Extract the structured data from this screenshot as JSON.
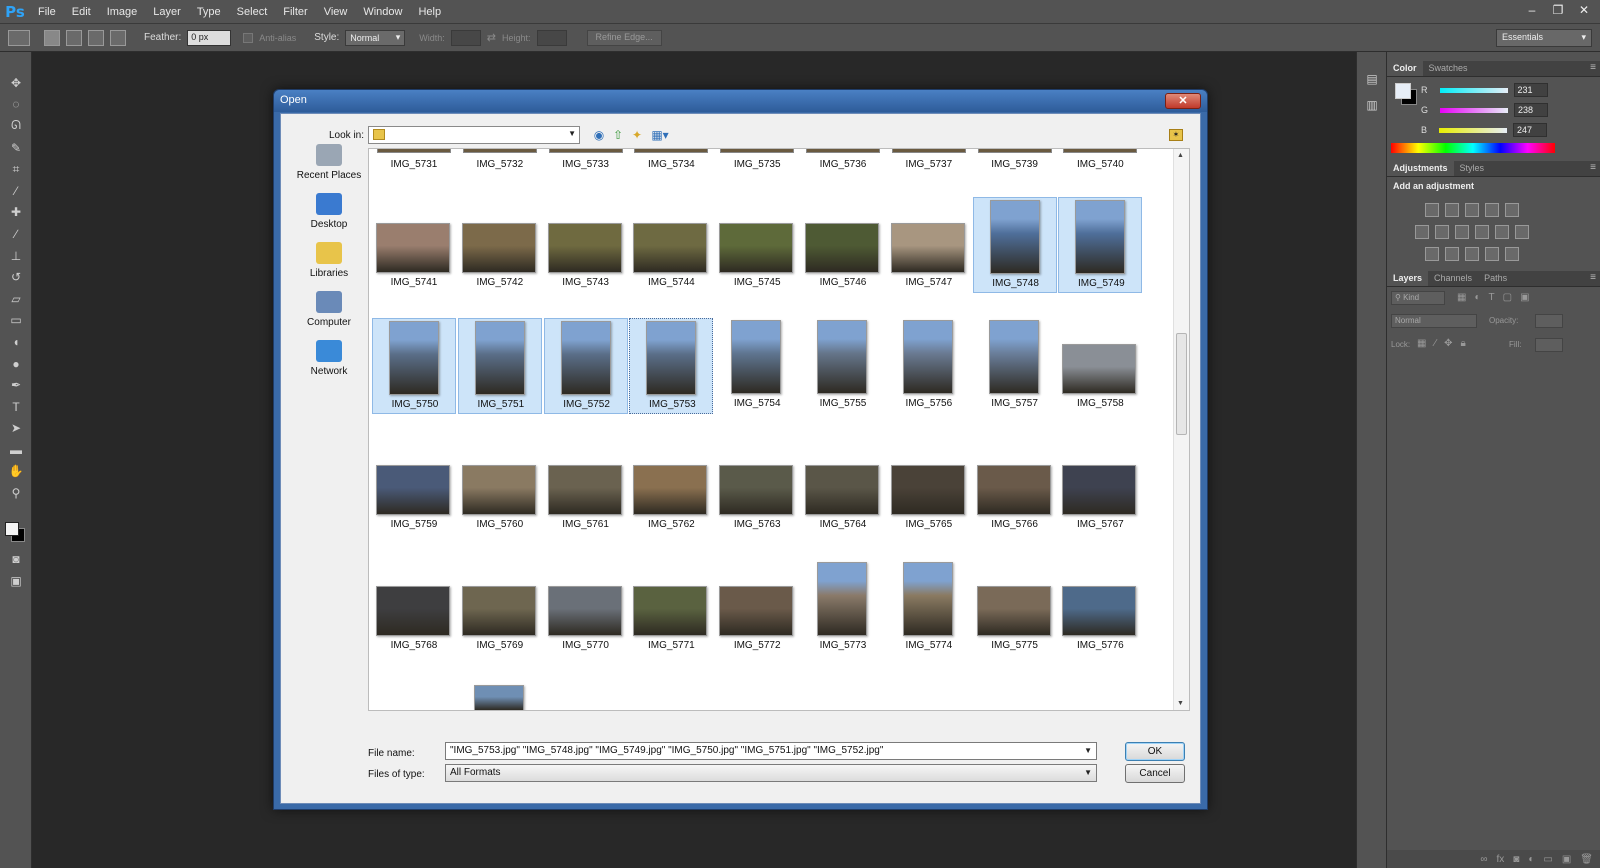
{
  "app": {
    "logo": "Ps",
    "menu": [
      "File",
      "Edit",
      "Image",
      "Layer",
      "Type",
      "Select",
      "Filter",
      "View",
      "Window",
      "Help"
    ],
    "window_controls": [
      "–",
      "❐",
      "✕"
    ]
  },
  "options_bar": {
    "feather_label": "Feather:",
    "feather_value": "0 px",
    "antialias_label": "Anti-alias",
    "style_label": "Style:",
    "style_value": "Normal",
    "width_label": "Width:",
    "height_label": "Height:",
    "refine_edge_label": "Refine Edge...",
    "workspace": "Essentials"
  },
  "panels": {
    "color": {
      "tabs": [
        "Color",
        "Swatches"
      ],
      "channels": [
        {
          "label": "R",
          "value": "231"
        },
        {
          "label": "G",
          "value": "238"
        },
        {
          "label": "B",
          "value": "247"
        }
      ]
    },
    "adjustments": {
      "tabs": [
        "Adjustments",
        "Styles"
      ],
      "heading": "Add an adjustment"
    },
    "layers": {
      "tabs": [
        "Layers",
        "Channels",
        "Paths"
      ],
      "kind_label": "Kind",
      "blend_mode": "Normal",
      "opacity_label": "Opacity:",
      "lock_label": "Lock:",
      "fill_label": "Fill:"
    }
  },
  "dialog": {
    "title": "Open",
    "close": "✕",
    "look_in_label": "Look in:",
    "look_in_value": "",
    "places": [
      {
        "name": "Recent Places",
        "icon": "recent-places-icon"
      },
      {
        "name": "Desktop",
        "icon": "desktop-icon"
      },
      {
        "name": "Libraries",
        "icon": "libraries-icon"
      },
      {
        "name": "Computer",
        "icon": "computer-icon"
      },
      {
        "name": "Network",
        "icon": "network-icon"
      }
    ],
    "top_row": [
      "IMG_5731",
      "IMG_5732",
      "IMG_5733",
      "IMG_5734",
      "IMG_5735",
      "IMG_5736",
      "IMG_5737",
      "IMG_5739",
      "IMG_5740"
    ],
    "rows": [
      {
        "files": [
          {
            "name": "IMG_5741",
            "orient": "landscape",
            "color": "#9a7e6e",
            "selected": false
          },
          {
            "name": "IMG_5742",
            "orient": "landscape",
            "color": "#7c6a4a",
            "selected": false
          },
          {
            "name": "IMG_5743",
            "orient": "landscape",
            "color": "#6f6a40",
            "selected": false
          },
          {
            "name": "IMG_5744",
            "orient": "landscape",
            "color": "#6e6a42",
            "selected": false
          },
          {
            "name": "IMG_5745",
            "orient": "landscape",
            "color": "#5e6a3a",
            "selected": false
          },
          {
            "name": "IMG_5746",
            "orient": "landscape",
            "color": "#4e5a34",
            "selected": false
          },
          {
            "name": "IMG_5747",
            "orient": "landscape",
            "color": "#a89680",
            "selected": false
          },
          {
            "name": "IMG_5748",
            "orient": "portrait",
            "color": "#4f6f9a",
            "selected": true
          },
          {
            "name": "IMG_5749",
            "orient": "portrait",
            "color": "#4f6f9a",
            "selected": true
          }
        ]
      },
      {
        "files": [
          {
            "name": "IMG_5750",
            "orient": "portrait",
            "color": "#5a6e88",
            "selected": true
          },
          {
            "name": "IMG_5751",
            "orient": "portrait",
            "color": "#5a6e88",
            "selected": true
          },
          {
            "name": "IMG_5752",
            "orient": "portrait",
            "color": "#5a6e88",
            "selected": true
          },
          {
            "name": "IMG_5753",
            "orient": "portrait",
            "color": "#5a6e88",
            "selected": true,
            "focused": true
          },
          {
            "name": "IMG_5754",
            "orient": "portrait",
            "color": "#5f7590",
            "selected": false
          },
          {
            "name": "IMG_5755",
            "orient": "portrait",
            "color": "#65758a",
            "selected": false
          },
          {
            "name": "IMG_5756",
            "orient": "portrait",
            "color": "#6a7a92",
            "selected": false
          },
          {
            "name": "IMG_5757",
            "orient": "portrait",
            "color": "#6a7e9a",
            "selected": false
          },
          {
            "name": "IMG_5758",
            "orient": "landscape",
            "color": "#8a8f96",
            "selected": false
          }
        ]
      },
      {
        "files": [
          {
            "name": "IMG_5759",
            "orient": "landscape",
            "color": "#4a5a78",
            "selected": false
          },
          {
            "name": "IMG_5760",
            "orient": "landscape",
            "color": "#8a7a62",
            "selected": false
          },
          {
            "name": "IMG_5761",
            "orient": "landscape",
            "color": "#6a6250",
            "selected": false
          },
          {
            "name": "IMG_5762",
            "orient": "landscape",
            "color": "#8a7050",
            "selected": false
          },
          {
            "name": "IMG_5763",
            "orient": "landscape",
            "color": "#5a5a4a",
            "selected": false
          },
          {
            "name": "IMG_5764",
            "orient": "landscape",
            "color": "#5a5648",
            "selected": false
          },
          {
            "name": "IMG_5765",
            "orient": "landscape",
            "color": "#4a4238",
            "selected": false
          },
          {
            "name": "IMG_5766",
            "orient": "landscape",
            "color": "#6a5a4a",
            "selected": false
          },
          {
            "name": "IMG_5767",
            "orient": "landscape",
            "color": "#3e4250",
            "selected": false
          }
        ]
      },
      {
        "files": [
          {
            "name": "IMG_5768",
            "orient": "landscape",
            "color": "#3e3e40",
            "selected": false
          },
          {
            "name": "IMG_5769",
            "orient": "landscape",
            "color": "#6e6650",
            "selected": false
          },
          {
            "name": "IMG_5770",
            "orient": "landscape",
            "color": "#6a7078",
            "selected": false
          },
          {
            "name": "IMG_5771",
            "orient": "landscape",
            "color": "#5a6240",
            "selected": false
          },
          {
            "name": "IMG_5772",
            "orient": "landscape",
            "color": "#6a5a4a",
            "selected": false
          },
          {
            "name": "IMG_5773",
            "orient": "portrait",
            "color": "#8a7a6a",
            "selected": false
          },
          {
            "name": "IMG_5774",
            "orient": "portrait",
            "color": "#8a7a62",
            "selected": false
          },
          {
            "name": "IMG_5775",
            "orient": "landscape",
            "color": "#7a6a58",
            "selected": false
          },
          {
            "name": "IMG_5776",
            "orient": "landscape",
            "color": "#4e6a8a",
            "selected": false
          }
        ]
      },
      {
        "files": [
          {
            "name": "",
            "orient": "partial",
            "color": "#6f8fb4",
            "selected": false,
            "col": 1
          }
        ]
      }
    ],
    "file_name_label": "File name:",
    "file_name_value": "\"IMG_5753.jpg\" \"IMG_5748.jpg\" \"IMG_5749.jpg\" \"IMG_5750.jpg\" \"IMG_5751.jpg\" \"IMG_5752.jpg\"",
    "file_type_label": "Files of type:",
    "file_type_value": "All Formats",
    "ok_label": "OK",
    "cancel_label": "Cancel"
  }
}
